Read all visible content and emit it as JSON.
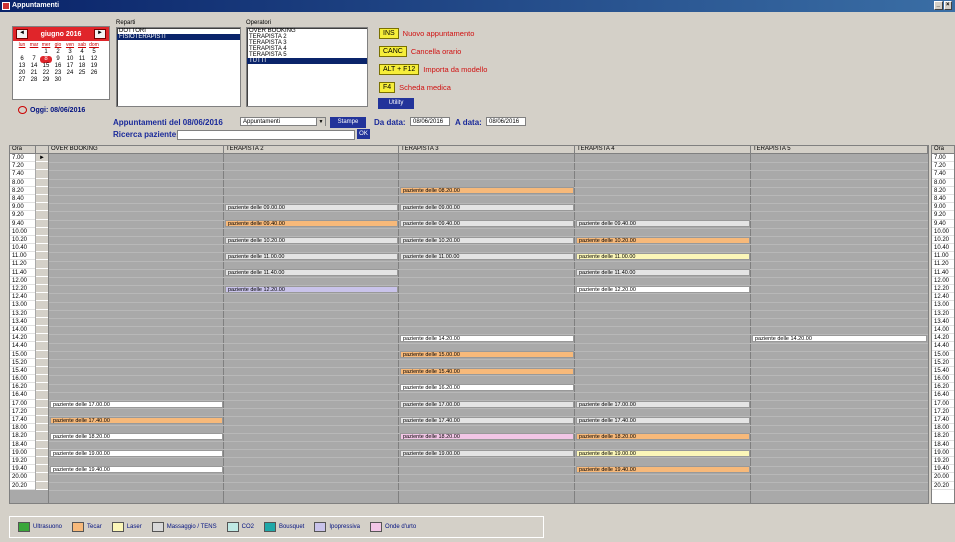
{
  "window": {
    "title": "Appuntamenti"
  },
  "calendar": {
    "month": "giugno 2016",
    "prev": "◄",
    "next": "►",
    "dows": [
      "lun",
      "mar",
      "mer",
      "gio",
      "ven",
      "sab",
      "dom"
    ],
    "weeks": [
      [
        "",
        "",
        "1",
        "2",
        "3",
        "4",
        "5"
      ],
      [
        "6",
        "7",
        "8",
        "9",
        "10",
        "11",
        "12"
      ],
      [
        "13",
        "14",
        "15",
        "16",
        "17",
        "18",
        "19"
      ],
      [
        "20",
        "21",
        "22",
        "23",
        "24",
        "25",
        "26"
      ],
      [
        "27",
        "28",
        "29",
        "30",
        "",
        "",
        ""
      ]
    ],
    "selected_day": "8",
    "today_label": "Oggi: 08/06/2016"
  },
  "reparti": {
    "label": "Reparti",
    "items": [
      "DOTTORI",
      "FISIOTERAPISTI"
    ],
    "selected": 1
  },
  "operatori": {
    "label": "Operatori",
    "items": [
      "OVER BOOKING",
      "TERAPISTA 2",
      "TERAPISTA 3",
      "TERAPISTA 4",
      "TERAPISTA 5",
      "TUTTI"
    ],
    "selected": 5
  },
  "shortcuts": [
    {
      "key": "INS",
      "text": "Nuovo appuntamento"
    },
    {
      "key": "CANC",
      "text": "Cancella orario"
    },
    {
      "key": "ALT + F12",
      "text": "Importa da modello"
    },
    {
      "key": "F4",
      "text": "Scheda medica"
    }
  ],
  "utility_label": "Utility",
  "appointments_of": "Appuntamenti del 08/06/2016",
  "view_select": "Appuntamenti",
  "stampa_label": "Stampe",
  "da_data_label": "Da data:",
  "da_data_value": "08/06/2016",
  "a_data_label": "A data:",
  "a_data_value": "08/06/2016",
  "ricerca_label": "Ricerca paziente:",
  "ok_label": "OK",
  "grid": {
    "time_header": "Ora",
    "columns": [
      "OVER BOOKING",
      "TERAPISTA 2",
      "TERAPISTA 3",
      "TERAPISTA 4",
      "TERAPISTA 5"
    ],
    "times": [
      "7.00",
      "7.20",
      "7.40",
      "8.00",
      "8.20",
      "8.40",
      "9.00",
      "9.20",
      "9.40",
      "10.00",
      "10.20",
      "10.40",
      "11.00",
      "11.20",
      "11.40",
      "12.00",
      "12.20",
      "12.40",
      "13.00",
      "13.20",
      "13.40",
      "14.00",
      "14.20",
      "14.40",
      "15.00",
      "15.20",
      "15.40",
      "16.00",
      "16.20",
      "16.40",
      "17.00",
      "17.20",
      "17.40",
      "18.00",
      "18.20",
      "18.40",
      "19.00",
      "19.20",
      "19.40",
      "20.00",
      "20.20"
    ],
    "current_marker": "►",
    "appointments": [
      {
        "col": 2,
        "row": 4,
        "text": "paziente delle 08.20.00",
        "color": "#f7b97a"
      },
      {
        "col": 1,
        "row": 6,
        "text": "paziente delle 09.00.00",
        "color": "#e4e4e4"
      },
      {
        "col": 2,
        "row": 6,
        "text": "paziente delle 09.00.00",
        "color": "#e4e4e4"
      },
      {
        "col": 1,
        "row": 8,
        "text": "paziente delle 09.40.00",
        "color": "#f7b97a"
      },
      {
        "col": 2,
        "row": 8,
        "text": "paziente delle 09.40.00",
        "color": "#e4e4e4"
      },
      {
        "col": 3,
        "row": 8,
        "text": "paziente delle 09.40.00",
        "color": "#e4e4e4"
      },
      {
        "col": 1,
        "row": 10,
        "text": "paziente delle 10.20.00",
        "color": "#e4e4e4"
      },
      {
        "col": 2,
        "row": 10,
        "text": "paziente delle 10.20.00",
        "color": "#e4e4e4"
      },
      {
        "col": 3,
        "row": 10,
        "text": "paziente delle 10.20.00",
        "color": "#f7b97a"
      },
      {
        "col": 1,
        "row": 12,
        "text": "paziente delle 11.00.00",
        "color": "#e4e4e4"
      },
      {
        "col": 2,
        "row": 12,
        "text": "paziente delle 11.00.00",
        "color": "#e4e4e4"
      },
      {
        "col": 3,
        "row": 12,
        "text": "paziente delle 11.00.00",
        "color": "#fbf6b8"
      },
      {
        "col": 1,
        "row": 14,
        "text": "paziente delle 11.40.00",
        "color": "#e4e4e4"
      },
      {
        "col": 3,
        "row": 14,
        "text": "paziente delle 11.40.00",
        "color": "#e4e4e4"
      },
      {
        "col": 1,
        "row": 16,
        "text": "paziente delle 12.20.00",
        "color": "#c9c3ea"
      },
      {
        "col": 3,
        "row": 16,
        "text": "paziente delle 12.20.00",
        "color": "#ffffff"
      },
      {
        "col": 2,
        "row": 22,
        "text": "paziente delle 14.20.00",
        "color": "#ffffff"
      },
      {
        "col": 4,
        "row": 22,
        "text": "paziente delle 14.20.00",
        "color": "#ffffff"
      },
      {
        "col": 2,
        "row": 24,
        "text": "paziente delle 15.00.00",
        "color": "#f7b97a"
      },
      {
        "col": 2,
        "row": 26,
        "text": "paziente delle 15.40.00",
        "color": "#f7b97a"
      },
      {
        "col": 2,
        "row": 28,
        "text": "paziente delle 16.20.00",
        "color": "#ffffff"
      },
      {
        "col": 0,
        "row": 30,
        "text": "paziente delle 17.00.00",
        "color": "#ffffff"
      },
      {
        "col": 2,
        "row": 30,
        "text": "paziente delle 17.00.00",
        "color": "#e4e4e4"
      },
      {
        "col": 3,
        "row": 30,
        "text": "paziente delle 17.00.00",
        "color": "#e4e4e4"
      },
      {
        "col": 0,
        "row": 32,
        "text": "paziente delle 17.40.00",
        "color": "#f7b97a"
      },
      {
        "col": 2,
        "row": 32,
        "text": "paziente delle 17.40.00",
        "color": "#e4e4e4"
      },
      {
        "col": 3,
        "row": 32,
        "text": "paziente delle 17.40.00",
        "color": "#e4e4e4"
      },
      {
        "col": 0,
        "row": 34,
        "text": "paziente delle 18.20.00",
        "color": "#ffffff"
      },
      {
        "col": 2,
        "row": 34,
        "text": "paziente delle 18.20.00",
        "color": "#f2c6e6"
      },
      {
        "col": 3,
        "row": 34,
        "text": "paziente delle 18.20.00",
        "color": "#f7b97a"
      },
      {
        "col": 0,
        "row": 36,
        "text": "paziente delle 19.00.00",
        "color": "#ffffff"
      },
      {
        "col": 2,
        "row": 36,
        "text": "paziente delle 19.00.00",
        "color": "#e4e4e4"
      },
      {
        "col": 3,
        "row": 36,
        "text": "paziente delle 19.00.00",
        "color": "#fbf6b8"
      },
      {
        "col": 0,
        "row": 38,
        "text": "paziente delle 19.40.00",
        "color": "#ffffff"
      },
      {
        "col": 3,
        "row": 38,
        "text": "paziente delle 19.40.00",
        "color": "#f7b97a"
      }
    ]
  },
  "legend": [
    {
      "label": "Ultrasuono",
      "color": "#3aa63a"
    },
    {
      "label": "Tecar",
      "color": "#f7b97a"
    },
    {
      "label": "Laser",
      "color": "#fbf6b8"
    },
    {
      "label": "Massaggio / TENS",
      "color": "#d8d8d8"
    },
    {
      "label": "CO2",
      "color": "#bfe9e4"
    },
    {
      "label": "Bousquet",
      "color": "#20a8a8"
    },
    {
      "label": "Ipopressiva",
      "color": "#c9c3ea"
    },
    {
      "label": "Onde d'urto",
      "color": "#f2c6e6"
    }
  ]
}
